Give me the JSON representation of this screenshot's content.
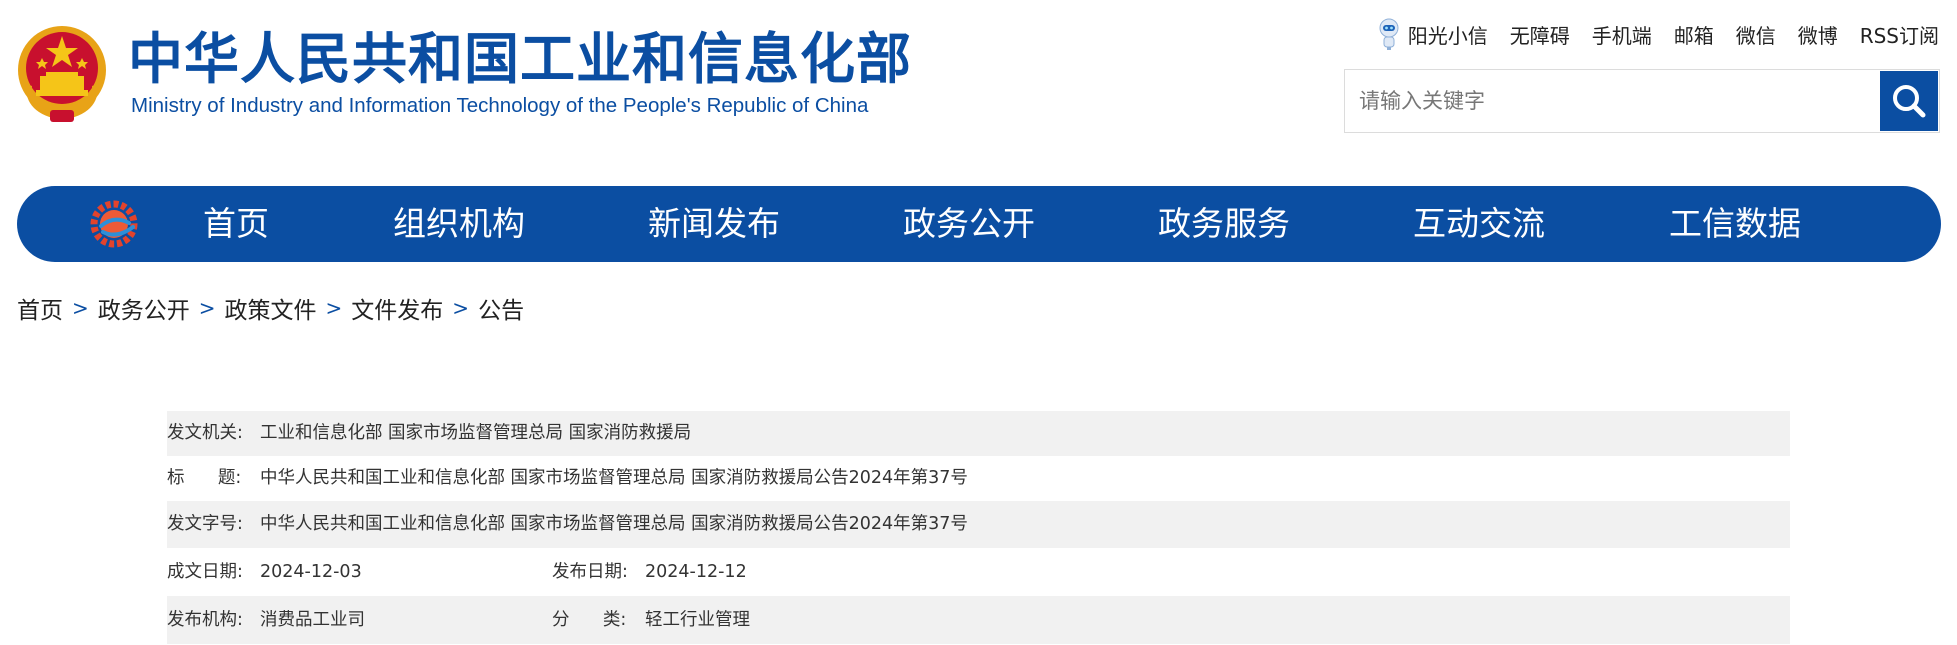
{
  "header": {
    "title_cn": "中华人民共和国工业和信息化部",
    "title_en": "Ministry of Industry and Information Technology of the People's Republic of China",
    "links": [
      "阳光小信",
      "无障碍",
      "手机端",
      "邮箱",
      "微信",
      "微博",
      "RSS订阅"
    ],
    "search_placeholder": "请输入关键字",
    "brand_color": "#0b4ea2"
  },
  "nav": {
    "items": [
      "首页",
      "组织机构",
      "新闻发布",
      "政务公开",
      "政务服务",
      "互动交流",
      "工信数据"
    ]
  },
  "breadcrumb": [
    "首页",
    "政务公开",
    "政策文件",
    "文件发布",
    "公告"
  ],
  "breadcrumb_sep": ">",
  "info": {
    "issuer_label": "发文机关:",
    "issuer": "工业和信息化部 国家市场监督管理总局 国家消防救援局",
    "title_label": "标      题:",
    "title": "中华人民共和国工业和信息化部 国家市场监督管理总局 国家消防救援局公告2024年第37号",
    "docno_label": "发文字号:",
    "docno": "中华人民共和国工业和信息化部 国家市场监督管理总局 国家消防救援局公告2024年第37号",
    "written_label": "成文日期:",
    "written_date": "2024-12-03",
    "published_label": "发布日期:",
    "published_date": "2024-12-12",
    "org_label": "发布机构:",
    "org": "消费品工业司",
    "category_label": "分      类:",
    "category": "轻工行业管理"
  }
}
